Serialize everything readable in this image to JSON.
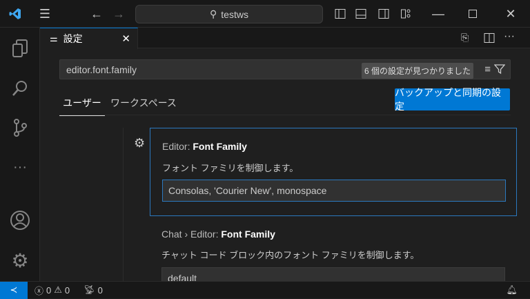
{
  "titlebar": {
    "search_text": "testws"
  },
  "tab": {
    "label": "設定"
  },
  "search": {
    "value": "editor.font.family",
    "result_count": "6 個の設定が見つかりました"
  },
  "scope_tabs": [
    {
      "label": "ユーザー"
    },
    {
      "label": "ワークスペース"
    }
  ],
  "sync_button": "バックアップと同期の設定",
  "settings": [
    {
      "category": "Editor: ",
      "name": "Font Family",
      "description": "フォント ファミリを制御します。",
      "value": "Consolas, 'Courier New', monospace"
    },
    {
      "category": "Chat › Editor: ",
      "name": "Font Family",
      "description": "チャット コード ブロック内のフォント ファミリを制御します。",
      "value": "default"
    }
  ],
  "status": {
    "errors": "0",
    "warnings": "0",
    "ports": "0"
  },
  "colors": {
    "accent": "#0078d4"
  }
}
